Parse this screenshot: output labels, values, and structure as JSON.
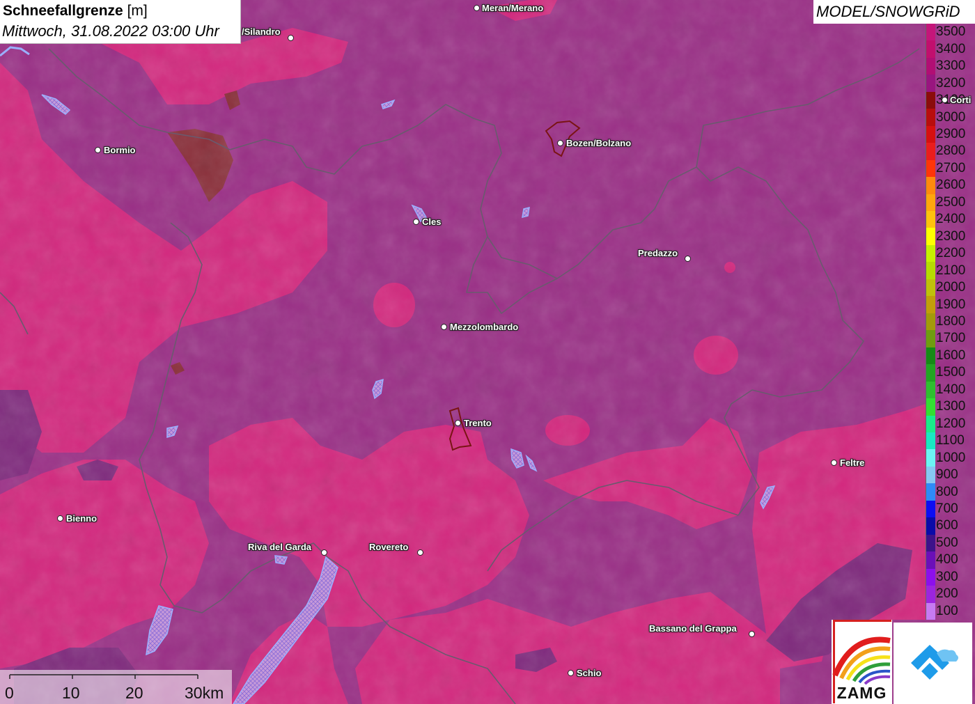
{
  "header": {
    "title": "Schneefallgrenze",
    "unit": "[m]",
    "datetime": "Mittwoch, 31.08.2022 03:00 Uhr"
  },
  "model_label": "MODEL/SNOWGRiD",
  "legend": {
    "items": [
      {
        "label": "3500",
        "color": "#c4167a"
      },
      {
        "label": "3400",
        "color": "#c10f6e"
      },
      {
        "label": "3300",
        "color": "#b10e74"
      },
      {
        "label": "3200",
        "color": "#99157f"
      },
      {
        "label": "3100",
        "color": "#8b0c0c"
      },
      {
        "label": "3000",
        "color": "#b80d0d"
      },
      {
        "label": "2900",
        "color": "#d61010"
      },
      {
        "label": "2800",
        "color": "#ea1d1d"
      },
      {
        "label": "2700",
        "color": "#ff3508"
      },
      {
        "label": "2600",
        "color": "#ff8a0d"
      },
      {
        "label": "2500",
        "color": "#ffa60d"
      },
      {
        "label": "2400",
        "color": "#ffc20d"
      },
      {
        "label": "2300",
        "color": "#ffff00"
      },
      {
        "label": "2200",
        "color": "#c6f000"
      },
      {
        "label": "2100",
        "color": "#b6dc00"
      },
      {
        "label": "2000",
        "color": "#c0c00a"
      },
      {
        "label": "1900",
        "color": "#c29e0a"
      },
      {
        "label": "1800",
        "color": "#a39a0a"
      },
      {
        "label": "1700",
        "color": "#6f9c10"
      },
      {
        "label": "1600",
        "color": "#168a16"
      },
      {
        "label": "1500",
        "color": "#22a522"
      },
      {
        "label": "1400",
        "color": "#2fbf2f"
      },
      {
        "label": "1300",
        "color": "#32e032"
      },
      {
        "label": "1200",
        "color": "#19ec8a"
      },
      {
        "label": "1100",
        "color": "#19e8c2"
      },
      {
        "label": "1000",
        "color": "#6cf4f4"
      },
      {
        "label": "900",
        "color": "#87c7f2"
      },
      {
        "label": "800",
        "color": "#2f8af7"
      },
      {
        "label": "700",
        "color": "#0d0df2"
      },
      {
        "label": "600",
        "color": "#0a0aa8"
      },
      {
        "label": "500",
        "color": "#3d128a"
      },
      {
        "label": "400",
        "color": "#6b0fb8"
      },
      {
        "label": "300",
        "color": "#8d0fec"
      },
      {
        "label": "200",
        "color": "#9c25de"
      },
      {
        "label": "100",
        "color": "#c77af2"
      }
    ]
  },
  "cities": [
    {
      "name": "Meran/Merano"
    },
    {
      "name": "/Silandro"
    },
    {
      "name": "Bormio"
    },
    {
      "name": "Bozen/Bolzano"
    },
    {
      "name": "Cles"
    },
    {
      "name": "Predazzo"
    },
    {
      "name": "Mezzolombardo"
    },
    {
      "name": "Trento"
    },
    {
      "name": "Feltre"
    },
    {
      "name": "Bienno"
    },
    {
      "name": "Riva del Garda"
    },
    {
      "name": "Rovereto"
    },
    {
      "name": "Bassano del Grappa"
    },
    {
      "name": "Schio"
    },
    {
      "name": "Corti"
    }
  ],
  "scale_bar": {
    "labels": [
      "0",
      "10",
      "20",
      "30km"
    ]
  },
  "logos": {
    "zamg_text": "ZAMG",
    "right_logo_icon": "snowgrid-logo-icon"
  },
  "colors": {
    "base_purple": "#9a2f86",
    "pink": "#d3287e",
    "dark_purple": "#7f2a7d",
    "brown": "#8a2f3a",
    "lake": "#9ab0ff"
  }
}
